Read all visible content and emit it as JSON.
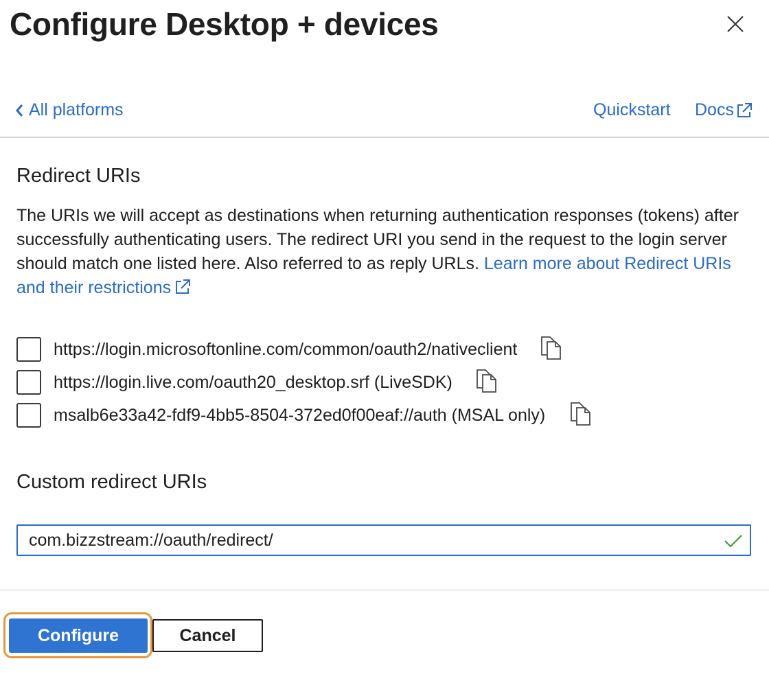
{
  "header": {
    "title": "Configure Desktop + devices",
    "close_icon": "close-icon"
  },
  "nav": {
    "back_label": "All platforms",
    "quickstart_label": "Quickstart",
    "docs_label": "Docs"
  },
  "redirect": {
    "heading": "Redirect URIs",
    "description": "The URIs we will accept as destinations when returning authentication responses (tokens) after successfully authenticating users. The redirect URI you send in the request to the login server should match one listed here. Also referred to as reply URLs.",
    "learn_more_label": "Learn more about Redirect URIs and their restrictions",
    "uris": [
      {
        "label": "https://login.microsoftonline.com/common/oauth2/nativeclient",
        "checked": false
      },
      {
        "label": "https://login.live.com/oauth20_desktop.srf (LiveSDK)",
        "checked": false
      },
      {
        "label": "msalb6e33a42-fdf9-4bb5-8504-372ed0f00eaf://auth (MSAL only)",
        "checked": false
      }
    ]
  },
  "custom": {
    "heading": "Custom redirect URIs",
    "value": "com.bizzstream://oauth/redirect/",
    "valid": true
  },
  "footer": {
    "configure_label": "Configure",
    "cancel_label": "Cancel"
  },
  "colors": {
    "link": "#2b6cc4",
    "primary": "#2f74d0",
    "focus_ring": "#e8963a",
    "valid_check": "#3f9b3a"
  }
}
